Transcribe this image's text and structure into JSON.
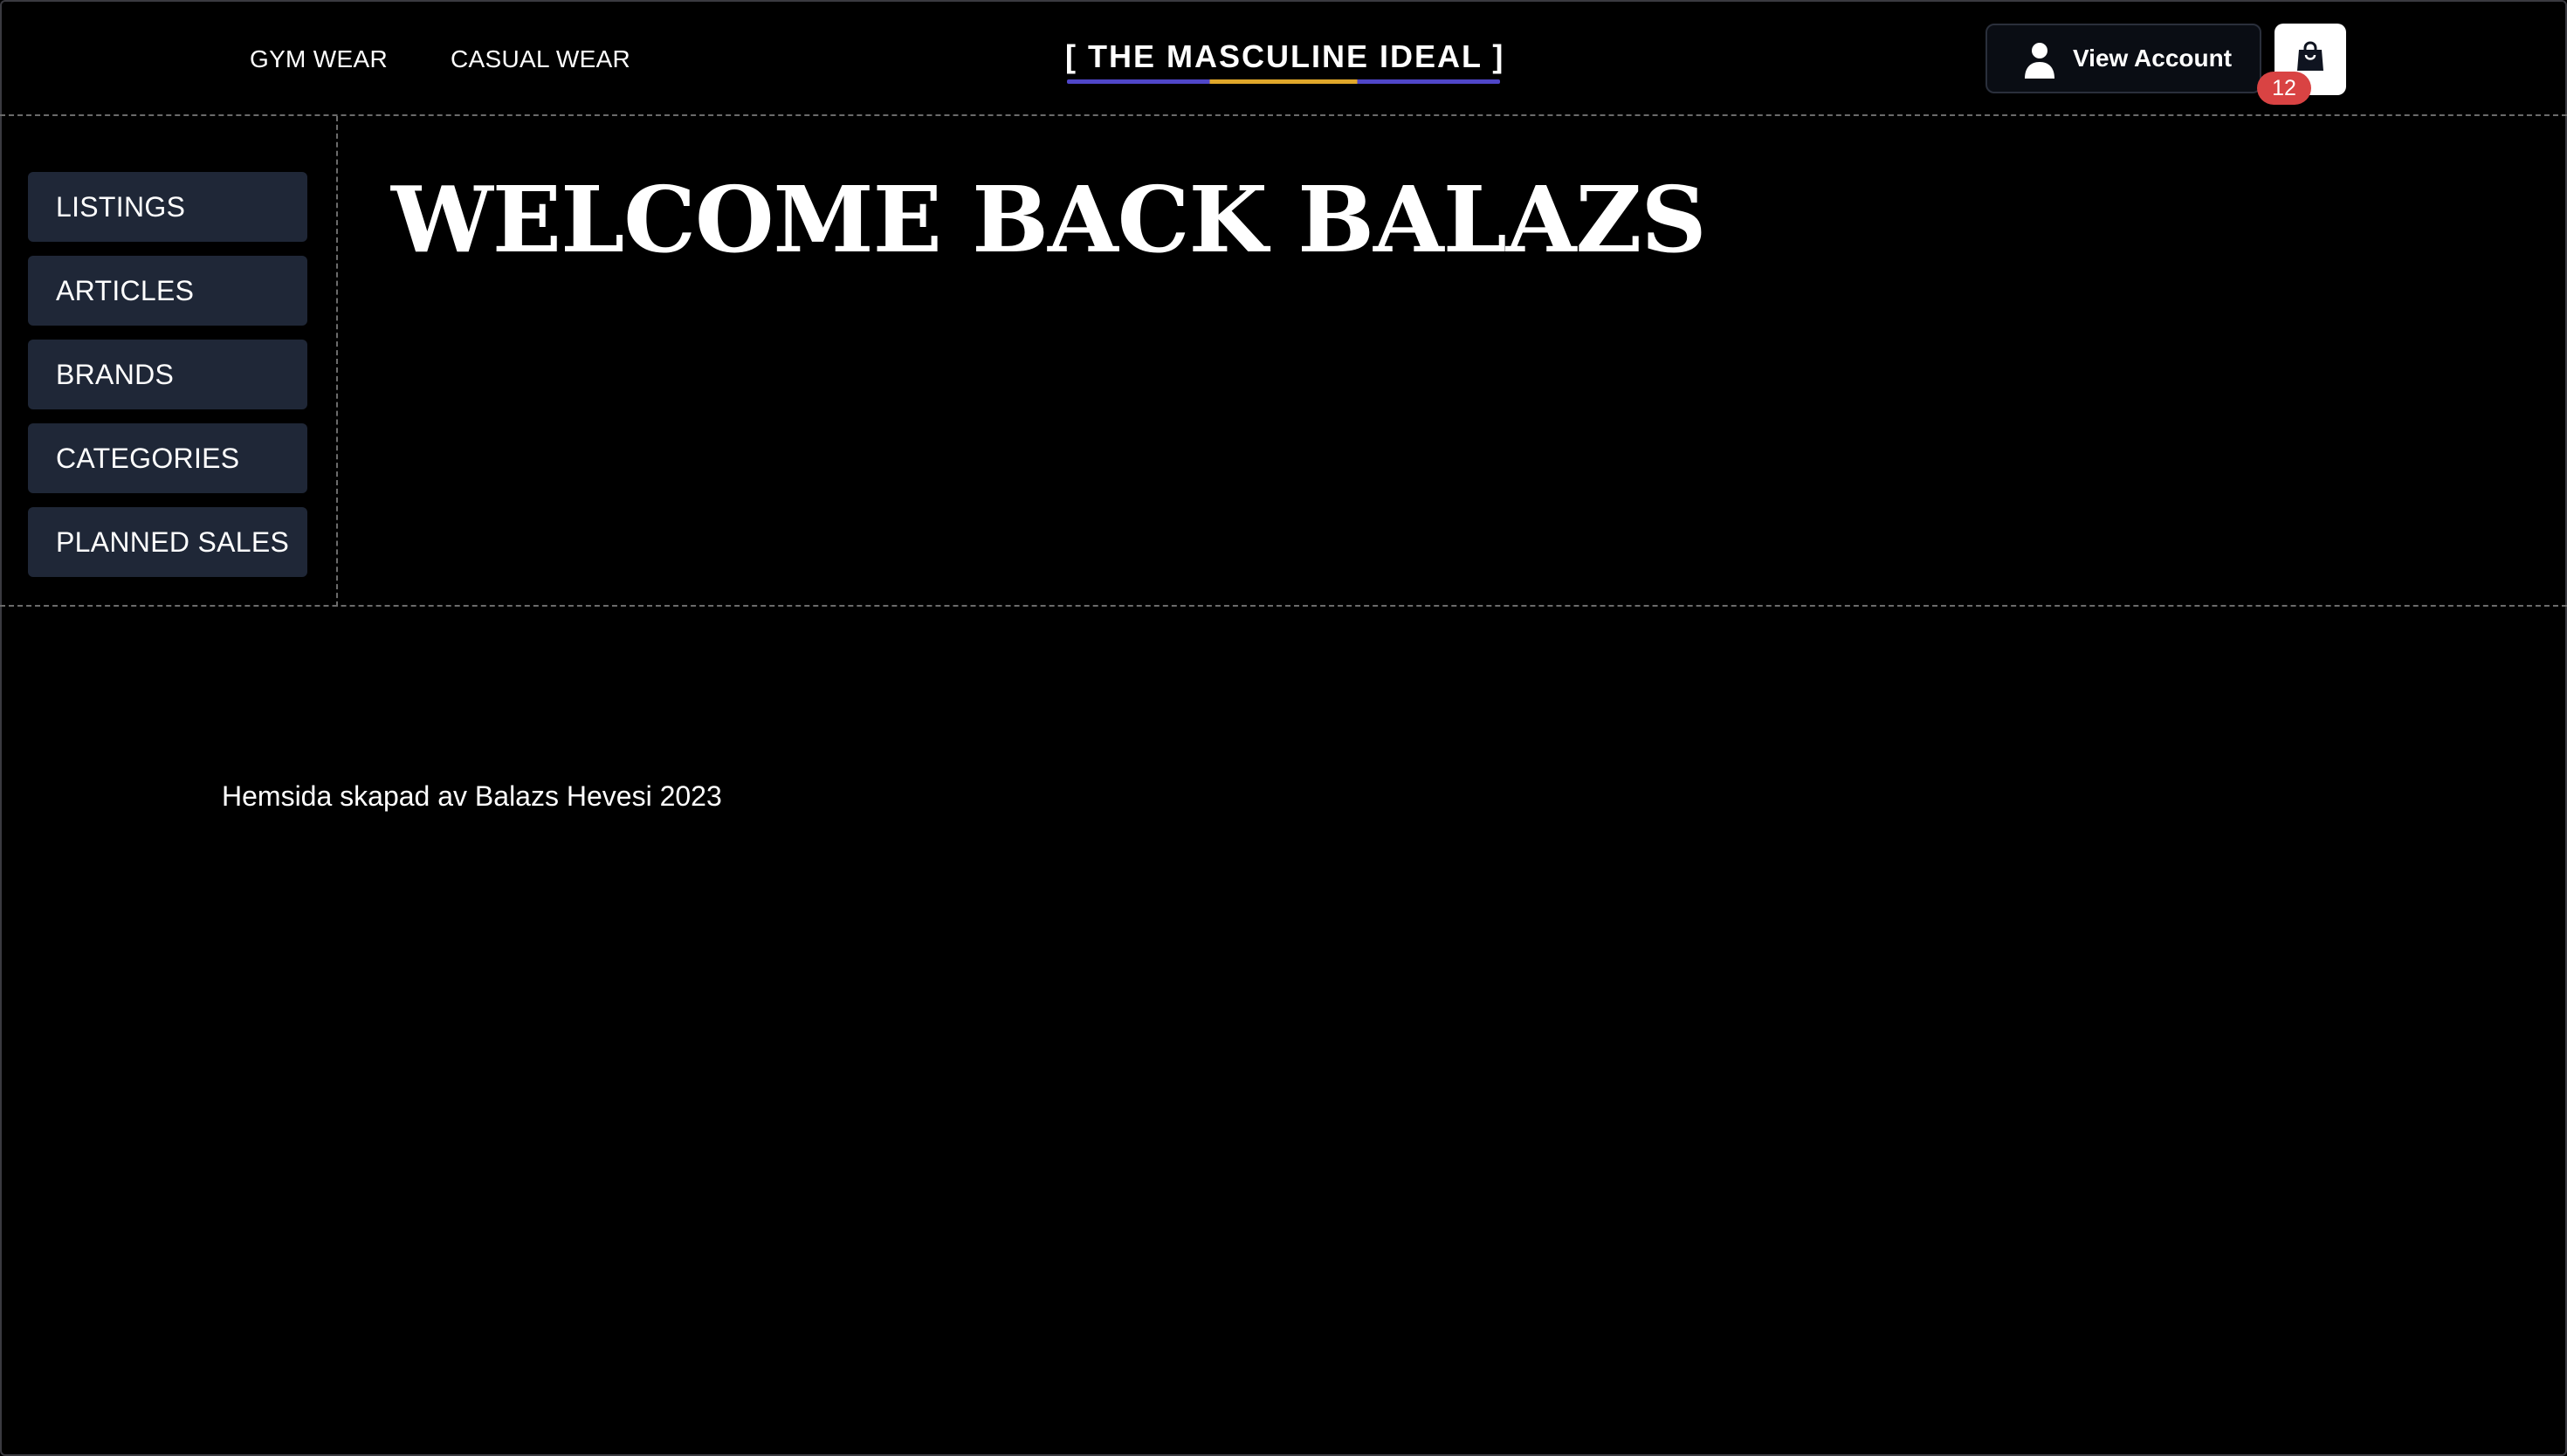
{
  "header": {
    "nav": [
      {
        "label": "GYM WEAR"
      },
      {
        "label": "CASUAL WEAR"
      }
    ],
    "logo_text": "[ THE MASCULINE IDEAL ]",
    "account_label": "View Account",
    "cart_count": "12"
  },
  "sidebar": {
    "items": [
      {
        "label": "LISTINGS"
      },
      {
        "label": "ARTICLES"
      },
      {
        "label": "BRANDS"
      },
      {
        "label": "CATEGORIES"
      },
      {
        "label": "PLANNED SALES"
      }
    ]
  },
  "main": {
    "welcome_text": "WELCOME BACK BALAZS"
  },
  "footer": {
    "text": "Hemsida skapad av Balazs Hevesi 2023"
  },
  "icons": {
    "account": "user-icon",
    "cart": "shopping-bag-icon"
  },
  "colors": {
    "background": "#000000",
    "sidebar_button": "#1f2737",
    "badge": "#d94343",
    "logo_underline_primary": "#4f46c8",
    "logo_underline_accent": "#e0a72a"
  }
}
